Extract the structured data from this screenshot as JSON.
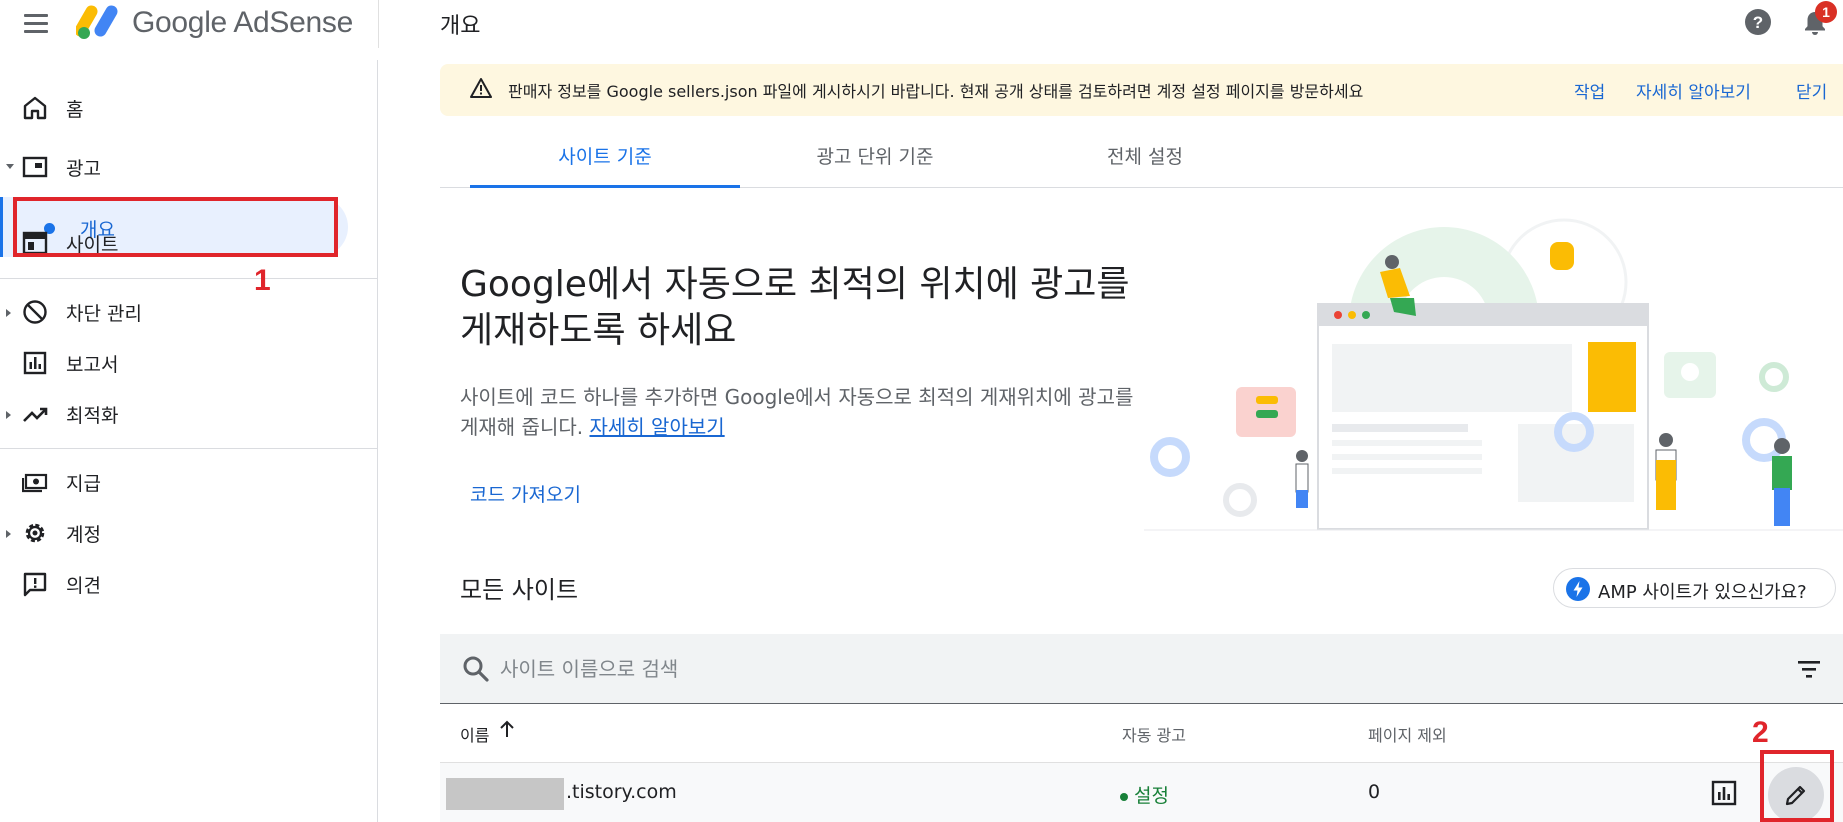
{
  "header": {
    "brand": "Google AdSense",
    "page_title": "개요",
    "notification_count": "1"
  },
  "sidebar": {
    "items": [
      {
        "label": "홈",
        "icon": "home-icon"
      },
      {
        "label": "광고",
        "icon": "ads-icon"
      },
      {
        "label": "개요",
        "icon": "dot-icon",
        "active": true
      },
      {
        "label": "사이트",
        "icon": "sites-icon"
      },
      {
        "label": "차단 관리",
        "icon": "block-icon"
      },
      {
        "label": "보고서",
        "icon": "reports-icon"
      },
      {
        "label": "최적화",
        "icon": "trending-icon"
      },
      {
        "label": "지급",
        "icon": "payments-icon"
      },
      {
        "label": "계정",
        "icon": "gear-icon"
      },
      {
        "label": "의견",
        "icon": "feedback-icon"
      }
    ]
  },
  "annotations": {
    "label_1": "1",
    "label_2": "2"
  },
  "banner": {
    "text": "판매자 정보를 Google sellers.json 파일에 게시하시기 바랍니다. 현재 공개 상태를 검토하려면 계정 설정 페이지를 방문하세요",
    "action": "작업",
    "learn_more": "자세히 알아보기",
    "dismiss": "닫기"
  },
  "tabs": [
    {
      "label": "사이트 기준",
      "active": true
    },
    {
      "label": "광고 단위 기준",
      "active": false
    },
    {
      "label": "전체 설정",
      "active": false
    }
  ],
  "hero": {
    "title": "Google에서 자동으로 최적의 위치에 광고를 게재하도록 하세요",
    "description": "사이트에 코드 하나를 추가하면 Google에서 자동으로 최적의 게재위치에 광고를 게재해 줍니다.",
    "learn_more": "자세히 알아보기",
    "code_link": "코드 가져오기"
  },
  "sites_section": {
    "title": "모든 사이트",
    "amp_button": "AMP 사이트가 있으신가요?",
    "search_placeholder": "사이트 이름으로 검색",
    "columns": [
      "이름",
      "자동 광고",
      "페이지 제외"
    ],
    "rows": [
      {
        "domain": ".tistory.com",
        "auto_ads": "설정",
        "excluded_pages": "0"
      }
    ]
  },
  "colors": {
    "accent": "#1a73e8",
    "annotation": "#e0252b",
    "banner_bg": "#fef7e0",
    "status_on": "#188038"
  }
}
